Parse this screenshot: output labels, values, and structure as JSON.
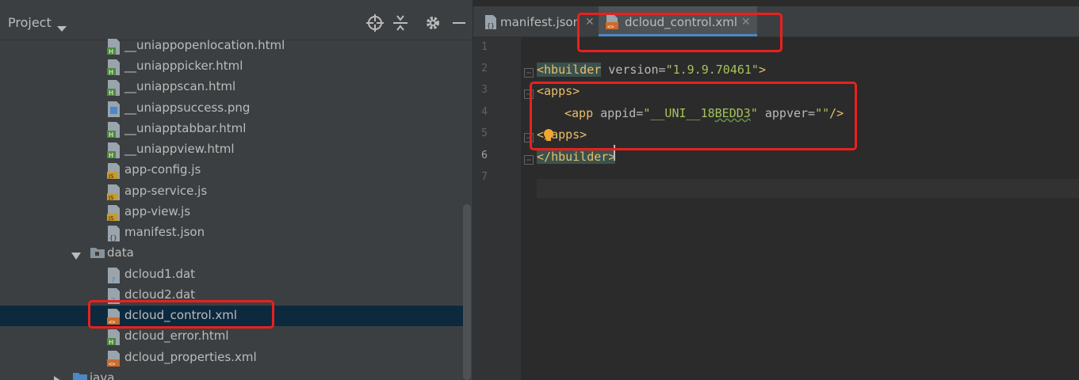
{
  "project_panel": {
    "title": "Project",
    "tree": [
      {
        "label": "__uniappopenlocation.html",
        "icon": "html-file-icon"
      },
      {
        "label": "__uniapppicker.html",
        "icon": "html-file-icon"
      },
      {
        "label": "__uniappscan.html",
        "icon": "html-file-icon"
      },
      {
        "label": "__uniappsuccess.png",
        "icon": "image-file-icon"
      },
      {
        "label": "__uniapptabbar.html",
        "icon": "html-file-icon"
      },
      {
        "label": "__uniappview.html",
        "icon": "html-file-icon"
      },
      {
        "label": "app-config.js",
        "icon": "js-file-icon"
      },
      {
        "label": "app-service.js",
        "icon": "js-file-icon"
      },
      {
        "label": "app-view.js",
        "icon": "js-file-icon"
      },
      {
        "label": "manifest.json",
        "icon": "json-file-icon"
      },
      {
        "label": "data",
        "icon": "folder-icon",
        "expanded": true
      },
      {
        "label": "dcloud1.dat",
        "icon": "unknown-file-icon"
      },
      {
        "label": "dcloud2.dat",
        "icon": "unknown-file-icon"
      },
      {
        "label": "dcloud_control.xml",
        "icon": "xml-file-icon",
        "selected": true
      },
      {
        "label": "dcloud_error.html",
        "icon": "html-file-icon"
      },
      {
        "label": "dcloud_properties.xml",
        "icon": "xml-file-icon"
      },
      {
        "label": "java",
        "icon": "folder-icon",
        "expanded": false
      }
    ]
  },
  "editor": {
    "tabs": [
      {
        "label": "manifest.json",
        "active": false
      },
      {
        "label": "dcloud_control.xml",
        "active": true
      }
    ],
    "line_numbers": [
      "1",
      "2",
      "3",
      "4",
      "5",
      "6",
      "7"
    ],
    "code": {
      "l2_tag_open": "<",
      "l2_tag_name": "hbuilder",
      "l2_attr": " version=",
      "l2_val": "\"1.9.9.70461\"",
      "l2_close": ">",
      "l3": "<apps>",
      "l4_tag": "<app",
      "l4_attr1": " appid=",
      "l4_val1_a": "\"__UNI__18",
      "l4_val1_b": "BEDD3",
      "l4_val1_c": "\"",
      "l4_attr2": " appver=",
      "l4_val2": "\"\"",
      "l4_close": "/>",
      "l5_a": "</",
      "l5_b": "apps>",
      "l6_a": "</",
      "l6_b": "hbuilder",
      "l6_c": ">"
    }
  },
  "colors": {
    "annotation": "#e8211e",
    "tag": "#e8bf6a",
    "string": "#a5c25c",
    "selection": "#0d293e",
    "tab_underline": "#4a88c7"
  }
}
